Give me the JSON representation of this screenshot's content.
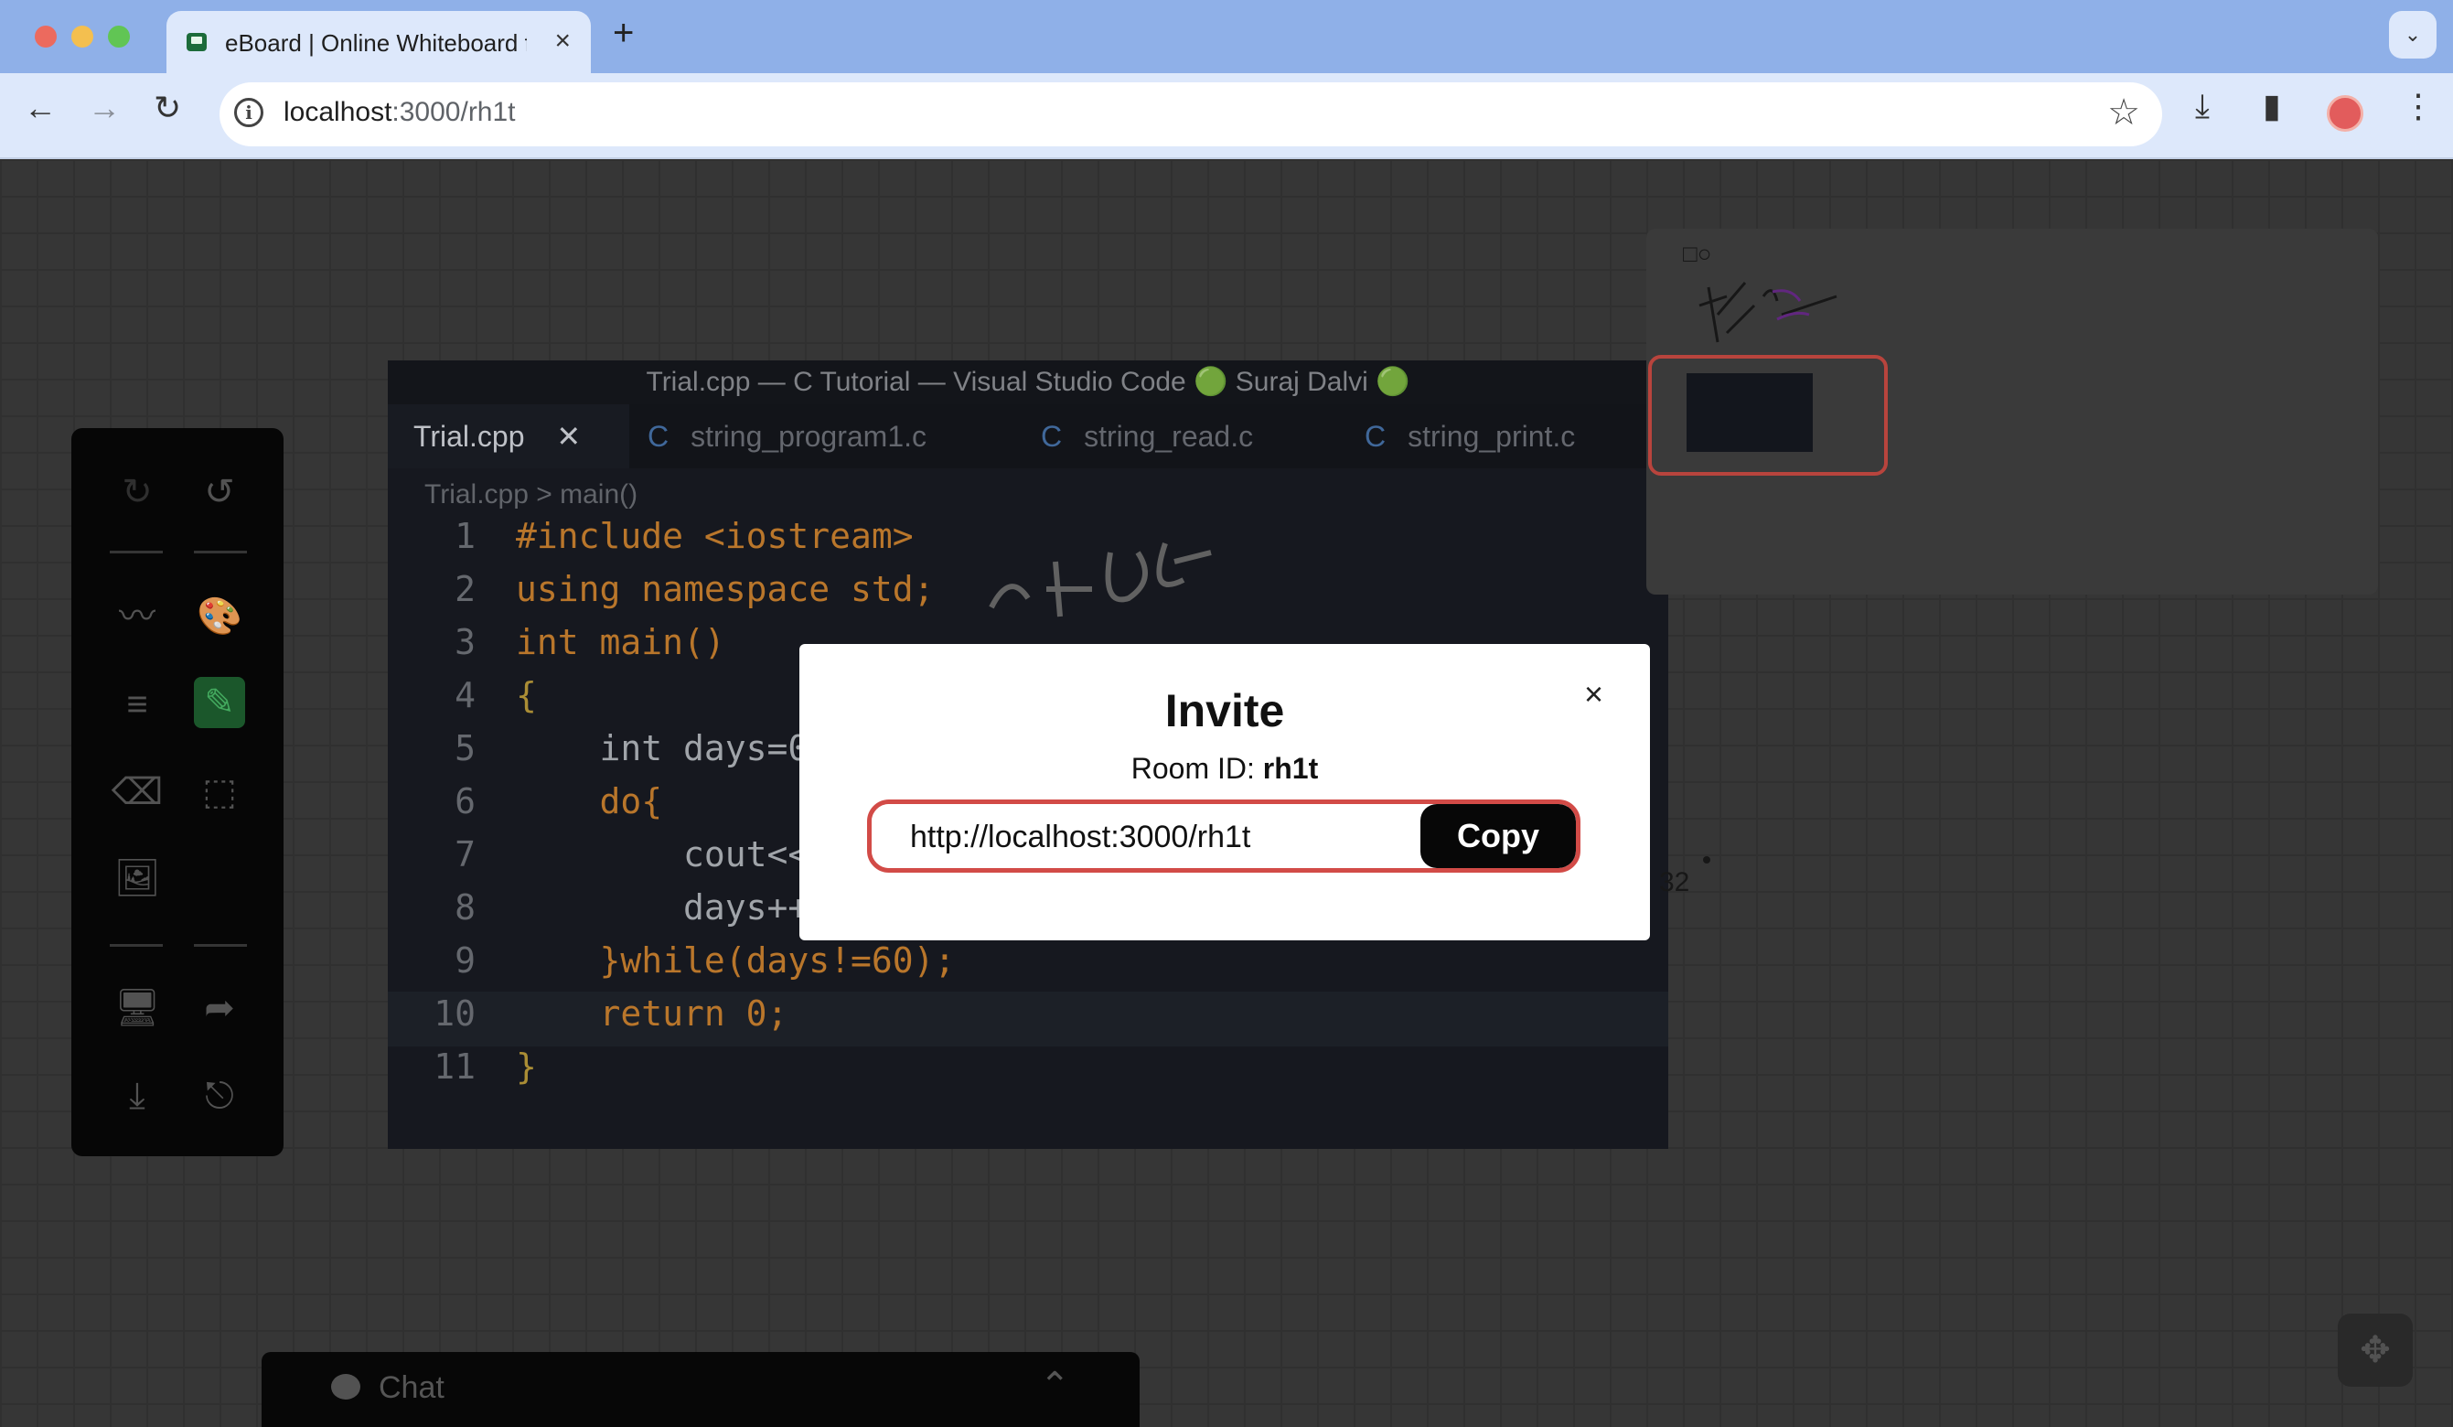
{
  "browser": {
    "tab_title": "eBoard | Online Whiteboard for",
    "tab_close": "×",
    "new_tab": "+",
    "tab_menu": "⌄",
    "url_host": "localhost",
    "url_path": ":3000/rh1t",
    "nav_back": "←",
    "nav_forward": "→",
    "nav_reload": "↻",
    "info_icon": "i",
    "star_icon": "☆",
    "download_icon": "⤓",
    "sidepanel_icon": "▮",
    "menu_icon": "⋮"
  },
  "vscode_screenshot": {
    "title": "Trial.cpp — C Tutorial — Visual Studio Code 🟢 Suraj Dalvi 🟢",
    "tabs": [
      {
        "label": "Trial.cpp",
        "close": "✕"
      },
      {
        "label": "string_program1.c",
        "prefix": "C"
      },
      {
        "label": "string_read.c",
        "prefix": "C"
      },
      {
        "label": "string_print.c",
        "prefix": "C"
      }
    ],
    "breadcrumb": "Trial.cpp > main()",
    "line_numbers": [
      "1",
      "2",
      "3",
      "4",
      "5",
      "6",
      "7",
      "8",
      "9",
      "10",
      "11"
    ],
    "lines": [
      "#include <iostream>",
      "using namespace std;",
      "int main()",
      "{",
      "    int days=0",
      "    do{",
      "        cout<<",
      "        days++;",
      "    }while(days!=60);",
      "    return 0;",
      "}"
    ]
  },
  "canvas": {
    "stray_text": "32",
    "minimap_shapes": "□○"
  },
  "tools": {
    "redo": "↻",
    "undo": "↺",
    "stroke_style": "〰",
    "color_palette": "🎨",
    "line_width": "≡",
    "pencil": "✎",
    "eraser": "⌫",
    "select": "⬚",
    "image": "🖼",
    "present": "🖥",
    "share": "➦",
    "download": "⤓",
    "exit": "⎋"
  },
  "chat": {
    "label": "Chat",
    "toggle": "⌃"
  },
  "fab_icon": "✥",
  "modal": {
    "title": "Invite",
    "room_label": "Room ID:",
    "room_id": "rh1t",
    "invite_link": "http://localhost:3000/rh1t",
    "copy_label": "Copy",
    "close": "×"
  },
  "colors": {
    "accent_red": "#d24b47",
    "pen_active_bg": "#1e5f2f",
    "canvas_bg": "#3b3b3b"
  }
}
